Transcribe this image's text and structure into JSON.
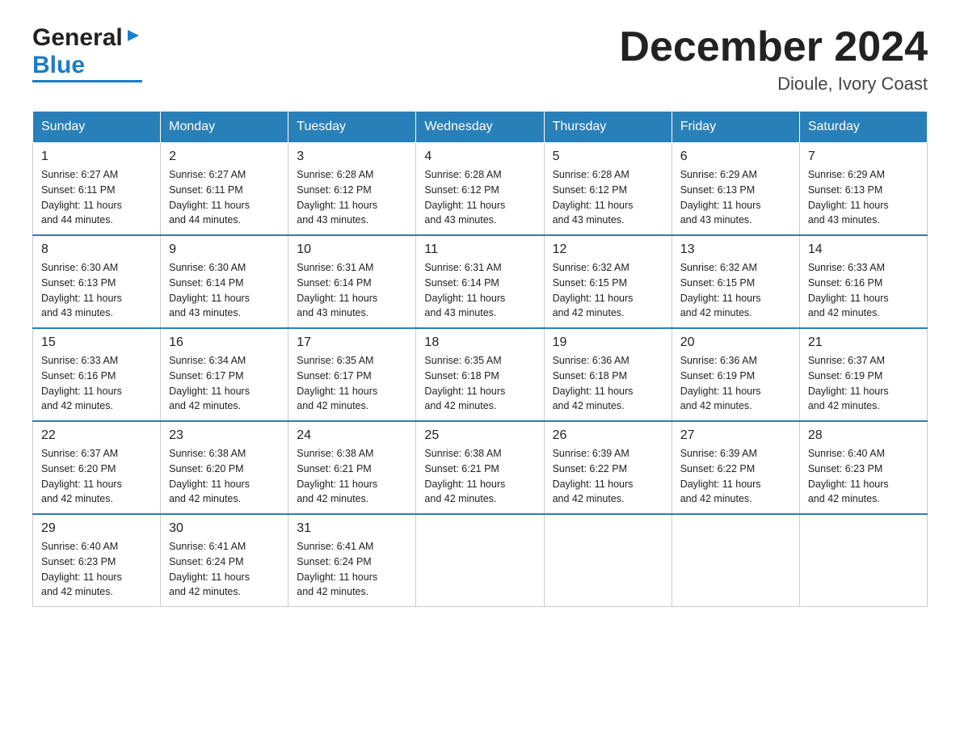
{
  "logo": {
    "general": "General",
    "arrow": "▶",
    "blue": "Blue"
  },
  "title": "December 2024",
  "subtitle": "Dioule, Ivory Coast",
  "days_of_week": [
    "Sunday",
    "Monday",
    "Tuesday",
    "Wednesday",
    "Thursday",
    "Friday",
    "Saturday"
  ],
  "weeks": [
    [
      {
        "day": "1",
        "sunrise": "6:27 AM",
        "sunset": "6:11 PM",
        "daylight": "11 hours and 44 minutes."
      },
      {
        "day": "2",
        "sunrise": "6:27 AM",
        "sunset": "6:11 PM",
        "daylight": "11 hours and 44 minutes."
      },
      {
        "day": "3",
        "sunrise": "6:28 AM",
        "sunset": "6:12 PM",
        "daylight": "11 hours and 43 minutes."
      },
      {
        "day": "4",
        "sunrise": "6:28 AM",
        "sunset": "6:12 PM",
        "daylight": "11 hours and 43 minutes."
      },
      {
        "day": "5",
        "sunrise": "6:28 AM",
        "sunset": "6:12 PM",
        "daylight": "11 hours and 43 minutes."
      },
      {
        "day": "6",
        "sunrise": "6:29 AM",
        "sunset": "6:13 PM",
        "daylight": "11 hours and 43 minutes."
      },
      {
        "day": "7",
        "sunrise": "6:29 AM",
        "sunset": "6:13 PM",
        "daylight": "11 hours and 43 minutes."
      }
    ],
    [
      {
        "day": "8",
        "sunrise": "6:30 AM",
        "sunset": "6:13 PM",
        "daylight": "11 hours and 43 minutes."
      },
      {
        "day": "9",
        "sunrise": "6:30 AM",
        "sunset": "6:14 PM",
        "daylight": "11 hours and 43 minutes."
      },
      {
        "day": "10",
        "sunrise": "6:31 AM",
        "sunset": "6:14 PM",
        "daylight": "11 hours and 43 minutes."
      },
      {
        "day": "11",
        "sunrise": "6:31 AM",
        "sunset": "6:14 PM",
        "daylight": "11 hours and 43 minutes."
      },
      {
        "day": "12",
        "sunrise": "6:32 AM",
        "sunset": "6:15 PM",
        "daylight": "11 hours and 42 minutes."
      },
      {
        "day": "13",
        "sunrise": "6:32 AM",
        "sunset": "6:15 PM",
        "daylight": "11 hours and 42 minutes."
      },
      {
        "day": "14",
        "sunrise": "6:33 AM",
        "sunset": "6:16 PM",
        "daylight": "11 hours and 42 minutes."
      }
    ],
    [
      {
        "day": "15",
        "sunrise": "6:33 AM",
        "sunset": "6:16 PM",
        "daylight": "11 hours and 42 minutes."
      },
      {
        "day": "16",
        "sunrise": "6:34 AM",
        "sunset": "6:17 PM",
        "daylight": "11 hours and 42 minutes."
      },
      {
        "day": "17",
        "sunrise": "6:35 AM",
        "sunset": "6:17 PM",
        "daylight": "11 hours and 42 minutes."
      },
      {
        "day": "18",
        "sunrise": "6:35 AM",
        "sunset": "6:18 PM",
        "daylight": "11 hours and 42 minutes."
      },
      {
        "day": "19",
        "sunrise": "6:36 AM",
        "sunset": "6:18 PM",
        "daylight": "11 hours and 42 minutes."
      },
      {
        "day": "20",
        "sunrise": "6:36 AM",
        "sunset": "6:19 PM",
        "daylight": "11 hours and 42 minutes."
      },
      {
        "day": "21",
        "sunrise": "6:37 AM",
        "sunset": "6:19 PM",
        "daylight": "11 hours and 42 minutes."
      }
    ],
    [
      {
        "day": "22",
        "sunrise": "6:37 AM",
        "sunset": "6:20 PM",
        "daylight": "11 hours and 42 minutes."
      },
      {
        "day": "23",
        "sunrise": "6:38 AM",
        "sunset": "6:20 PM",
        "daylight": "11 hours and 42 minutes."
      },
      {
        "day": "24",
        "sunrise": "6:38 AM",
        "sunset": "6:21 PM",
        "daylight": "11 hours and 42 minutes."
      },
      {
        "day": "25",
        "sunrise": "6:38 AM",
        "sunset": "6:21 PM",
        "daylight": "11 hours and 42 minutes."
      },
      {
        "day": "26",
        "sunrise": "6:39 AM",
        "sunset": "6:22 PM",
        "daylight": "11 hours and 42 minutes."
      },
      {
        "day": "27",
        "sunrise": "6:39 AM",
        "sunset": "6:22 PM",
        "daylight": "11 hours and 42 minutes."
      },
      {
        "day": "28",
        "sunrise": "6:40 AM",
        "sunset": "6:23 PM",
        "daylight": "11 hours and 42 minutes."
      }
    ],
    [
      {
        "day": "29",
        "sunrise": "6:40 AM",
        "sunset": "6:23 PM",
        "daylight": "11 hours and 42 minutes."
      },
      {
        "day": "30",
        "sunrise": "6:41 AM",
        "sunset": "6:24 PM",
        "daylight": "11 hours and 42 minutes."
      },
      {
        "day": "31",
        "sunrise": "6:41 AM",
        "sunset": "6:24 PM",
        "daylight": "11 hours and 42 minutes."
      },
      null,
      null,
      null,
      null
    ]
  ],
  "labels": {
    "sunrise": "Sunrise:",
    "sunset": "Sunset:",
    "daylight": "Daylight:"
  },
  "colors": {
    "header_bg": "#2980b9",
    "header_text": "#ffffff",
    "border": "#cccccc",
    "row_separator": "#2980b9"
  }
}
